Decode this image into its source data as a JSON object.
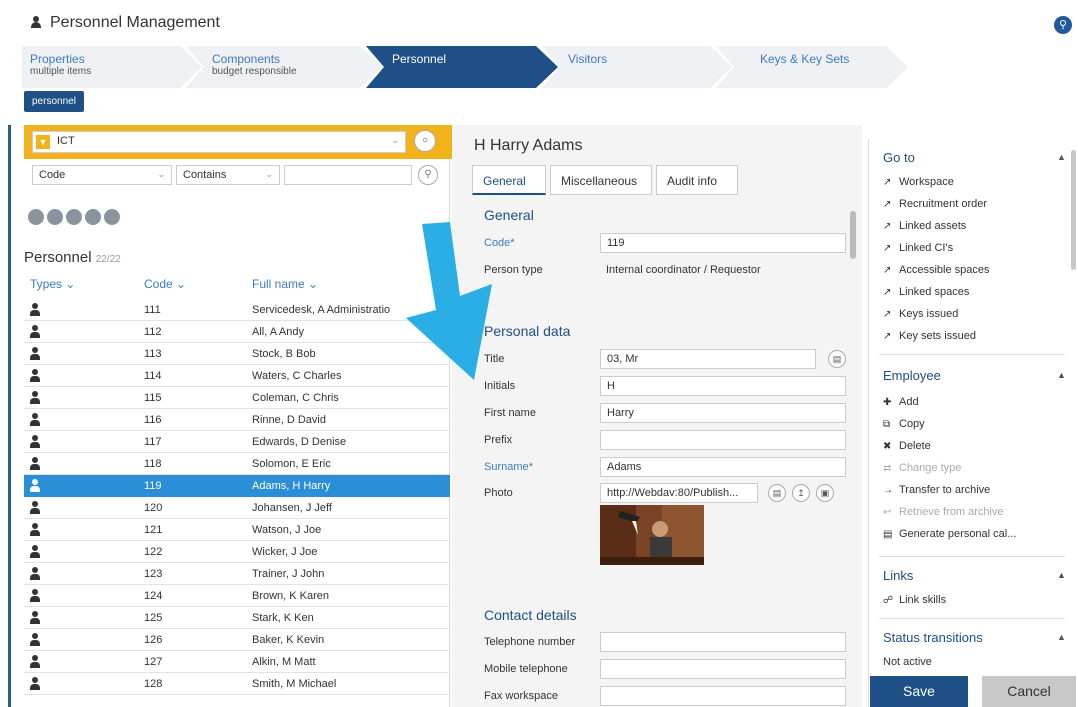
{
  "app": {
    "title": "Personnel Management"
  },
  "steps": [
    {
      "label": "Properties",
      "sub": "multiple items"
    },
    {
      "label": "Components",
      "sub": "budget responsible"
    },
    {
      "label": "Personnel",
      "sub": ""
    },
    {
      "label": "Visitors",
      "sub": ""
    },
    {
      "label": "Keys & Key Sets",
      "sub": ""
    }
  ],
  "active_step": "Personnel",
  "filter_chip": "personnel",
  "filter": {
    "value": "ICT"
  },
  "search": {
    "field": "Code",
    "operator": "Contains",
    "value": ""
  },
  "list": {
    "title": "Personnel",
    "count": "22/22",
    "columns": [
      "Types",
      "Code",
      "Full name"
    ],
    "rows": [
      {
        "code": "111",
        "name": "Servicedesk, A Administratio"
      },
      {
        "code": "112",
        "name": "All, A Andy"
      },
      {
        "code": "113",
        "name": "Stock, B Bob"
      },
      {
        "code": "114",
        "name": "Waters, C Charles"
      },
      {
        "code": "115",
        "name": "Coleman, C Chris"
      },
      {
        "code": "116",
        "name": "Rinne, D David"
      },
      {
        "code": "117",
        "name": "Edwards, D Denise"
      },
      {
        "code": "118",
        "name": "Solomon, E Eric"
      },
      {
        "code": "119",
        "name": "Adams, H Harry"
      },
      {
        "code": "120",
        "name": "Johansen, J Jeff"
      },
      {
        "code": "121",
        "name": "Watson, J Joe"
      },
      {
        "code": "122",
        "name": "Wicker, J Joe"
      },
      {
        "code": "123",
        "name": "Trainer, J John"
      },
      {
        "code": "124",
        "name": "Brown, K Karen"
      },
      {
        "code": "125",
        "name": "Stark, K Ken"
      },
      {
        "code": "126",
        "name": "Baker, K Kevin"
      },
      {
        "code": "127",
        "name": "Alkin, M Matt"
      },
      {
        "code": "128",
        "name": "Smith, M Michael"
      }
    ],
    "selected_code": "119"
  },
  "detail": {
    "title": "H Harry Adams",
    "tabs": [
      "General",
      "Miscellaneous",
      "Audit info"
    ],
    "active_tab": "General",
    "general": {
      "heading": "General",
      "code_label": "Code*",
      "code_value": "119",
      "person_type_label": "Person type",
      "person_type_value": "Internal coordinator / Requestor"
    },
    "personal": {
      "heading": "Personal data",
      "title_label": "Title",
      "title_value": "03, Mr",
      "initials_label": "Initials",
      "initials_value": "H",
      "first_name_label": "First name",
      "first_name_value": "Harry",
      "prefix_label": "Prefix",
      "prefix_value": "",
      "surname_label": "Surname*",
      "surname_value": "Adams",
      "photo_label": "Photo",
      "photo_value": "http://Webdav:80/Publish..."
    },
    "contact": {
      "heading": "Contact details",
      "telephone_label": "Telephone number",
      "mobile_label": "Mobile telephone",
      "fax_label": "Fax workspace"
    }
  },
  "sidebar": {
    "goto": {
      "heading": "Go to",
      "items": [
        "Workspace",
        "Recruitment order",
        "Linked assets",
        "Linked CI's",
        "Accessible spaces",
        "Linked spaces",
        "Keys issued",
        "Key sets issued"
      ]
    },
    "employee": {
      "heading": "Employee",
      "items": [
        {
          "label": "Add",
          "disabled": false
        },
        {
          "label": "Copy",
          "disabled": false
        },
        {
          "label": "Delete",
          "disabled": false
        },
        {
          "label": "Change type",
          "disabled": true
        },
        {
          "label": "Transfer to archive",
          "disabled": false
        },
        {
          "label": "Retrieve from archive",
          "disabled": true
        },
        {
          "label": "Generate personal cal...",
          "disabled": false
        }
      ]
    },
    "links": {
      "heading": "Links",
      "items": [
        "Link skills"
      ]
    },
    "status": {
      "heading": "Status transitions",
      "items": [
        "Not active"
      ]
    }
  },
  "buttons": {
    "save": "Save",
    "cancel": "Cancel"
  },
  "colors": {
    "primary": "#1e4f86",
    "accent": "#2a8fd6",
    "filter": "#f2b21b",
    "arrow": "#29aee6"
  }
}
